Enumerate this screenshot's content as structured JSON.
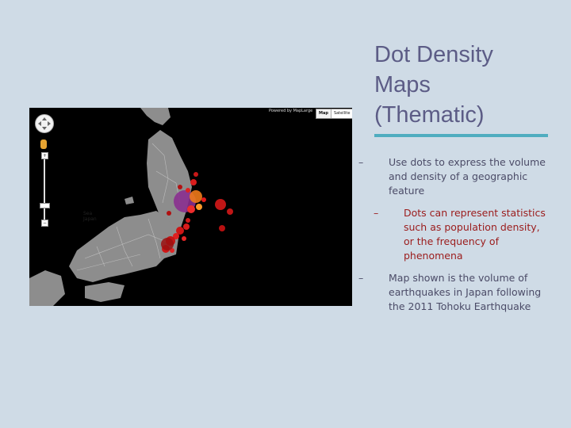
{
  "slide": {
    "title_lines": [
      "Dot Density",
      "Maps",
      "(Thematic)"
    ],
    "bullets": [
      {
        "dash": "–",
        "text": "Use dots to express the volume and density of a geographic feature"
      },
      {
        "dash": "–",
        "text": "Dots can represent statistics such as population density, or the frequency of phenomena"
      },
      {
        "dash": "–",
        "text": "Map shown is the volume of earthquakes in Japan following the 2011 Tohoku Earthquake"
      }
    ],
    "colors": {
      "background": "#cfdbe6",
      "title": "#5c5c86",
      "rule": "#4fadc0",
      "sub_bullet": "#9b1b1b"
    }
  },
  "map": {
    "attribution": "Powered by MapLarge",
    "toggle": {
      "map_label": "Map",
      "satellite_label": "Satellite"
    },
    "labels": {
      "sea_line1": "Sea",
      "sea_line2": "Japan"
    },
    "icons": [
      "pan-control-icon",
      "pegman-icon",
      "zoom-in-icon",
      "zoom-out-icon"
    ]
  }
}
